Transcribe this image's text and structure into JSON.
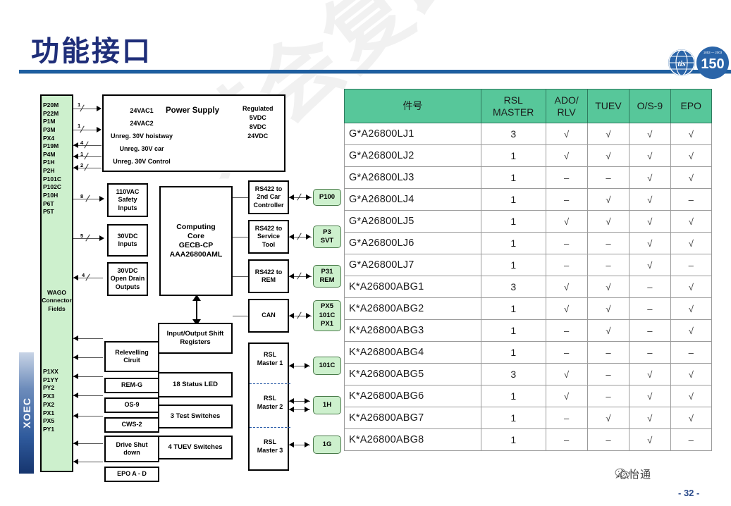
{
  "header": {
    "title": "功能接口",
    "rule_color": "#1f5fa0",
    "title_color": "#1f2e79"
  },
  "watermark": {
    "text": "禁会复印"
  },
  "logos": {
    "globe": "otis-globe-logo",
    "anniversary": "150-anniversary-logo",
    "anniversary_text": "150",
    "color": "#2a64a8"
  },
  "sidebar": {
    "label": "XOEC"
  },
  "diagram": {
    "wago": {
      "title": "WAGO\nConnector\nFields",
      "title_lines": [
        "WAGO",
        "Connector",
        "Fields"
      ],
      "top_labels": [
        "P20M",
        "P22M",
        "P1M",
        "P3M",
        "PX4",
        "P19M",
        "P4M",
        "P1H",
        "P2H",
        "P101C",
        "P102C",
        "P10H",
        "P6T",
        "P5T"
      ],
      "bottom_labels": [
        "P1XX",
        "P1YY",
        "PY2",
        "PX3",
        "PX2",
        "PX1",
        "PX5",
        "PY1"
      ],
      "fill": "#cdf0cd"
    },
    "power_supply": {
      "title": "Power Supply",
      "inputs": [
        "24VAC1",
        "24VAC2",
        "Unreg. 30V hoistway",
        "Unreg. 30V car",
        "Unreg. 30V Control"
      ],
      "outputs": [
        "Regulated",
        "5VDC",
        "8VDC",
        "24VDC"
      ]
    },
    "io_boxes": [
      {
        "name": "safety-inputs-box",
        "lines": [
          "110VAC",
          "Safety",
          "Inputs"
        ]
      },
      {
        "name": "dc-inputs-box",
        "lines": [
          "30VDC",
          "Inputs"
        ]
      },
      {
        "name": "open-drain-outputs-box",
        "lines": [
          "30VDC",
          "Open Drain",
          "Outputs"
        ]
      }
    ],
    "computing_core": {
      "lines": [
        "Computing",
        "Core",
        "GECB-CP",
        "AAA26800AML"
      ]
    },
    "comm_boxes": [
      {
        "name": "rs422-2nd-car-box",
        "lines": [
          "RS422 to",
          "2nd Car",
          "Controller"
        ]
      },
      {
        "name": "rs422-service-tool-box",
        "lines": [
          "RS422 to",
          "Service",
          "Tool"
        ]
      },
      {
        "name": "rs422-rem-box",
        "lines": [
          "RS422 to",
          "REM"
        ]
      },
      {
        "name": "can-box",
        "lines": [
          "CAN"
        ]
      }
    ],
    "ports": [
      {
        "name": "port-p100",
        "lines": [
          "P100"
        ]
      },
      {
        "name": "port-p3-svt",
        "lines": [
          "P3",
          "SVT"
        ]
      },
      {
        "name": "port-p31-rem",
        "lines": [
          "P31",
          "REM"
        ]
      },
      {
        "name": "port-px5-101c-px1",
        "lines": [
          "PX5",
          "101C",
          "PX1"
        ]
      },
      {
        "name": "port-101c",
        "lines": [
          "101C"
        ]
      },
      {
        "name": "port-1h",
        "lines": [
          "1H"
        ]
      },
      {
        "name": "port-1g",
        "lines": [
          "1G"
        ]
      }
    ],
    "rsl_masters": [
      "RSL\nMaster 1",
      "RSL\nMaster 2",
      "RSL\nMaster 3"
    ],
    "rsl_master_items": [
      {
        "lines": [
          "RSL",
          "Master 1"
        ]
      },
      {
        "lines": [
          "RSL",
          "Master 2"
        ]
      },
      {
        "lines": [
          "RSL",
          "Master 3"
        ]
      }
    ],
    "shift_registers": {
      "lines": [
        "Input/Output Shift",
        "Registers"
      ]
    },
    "left_lower_boxes": [
      {
        "name": "relevelling-circuit-box",
        "lines": [
          "Relevelling",
          "Ciruit"
        ]
      },
      {
        "name": "rem-g-box",
        "lines": [
          "REM-G"
        ]
      },
      {
        "name": "os-9-box",
        "lines": [
          "OS-9"
        ]
      },
      {
        "name": "cws-2-box",
        "lines": [
          "CWS-2"
        ]
      },
      {
        "name": "drive-shutdown-box",
        "lines": [
          "Drive Shut",
          "down"
        ]
      },
      {
        "name": "epo-a-d-box",
        "lines": [
          "EPO A - D"
        ]
      }
    ],
    "right_lower_boxes": [
      {
        "name": "status-led-box",
        "lines": [
          "18 Status  LED"
        ]
      },
      {
        "name": "test-switches-box",
        "lines": [
          "3 Test Switches"
        ]
      },
      {
        "name": "tuev-switches-box",
        "lines": [
          "4 TUEV Switches"
        ]
      }
    ],
    "wire_counts": [
      "1",
      "1",
      "4",
      "1",
      "2",
      "8",
      "5",
      "4"
    ]
  },
  "table": {
    "header_color": "#57c79a",
    "columns": [
      {
        "key": "part",
        "label": "件号"
      },
      {
        "key": "rsl",
        "label": "RSL\nMASTER",
        "lines": [
          "RSL",
          "MASTER"
        ]
      },
      {
        "key": "ado",
        "label": "ADO/\nRLV",
        "lines": [
          "ADO/",
          "RLV"
        ]
      },
      {
        "key": "tuev",
        "label": "TUEV",
        "lines": [
          "TUEV"
        ]
      },
      {
        "key": "os9",
        "label": "O/S-9",
        "lines": [
          "O/S-9"
        ]
      },
      {
        "key": "epo",
        "label": "EPO",
        "lines": [
          "EPO"
        ]
      }
    ],
    "rows": [
      {
        "part": "G*A26800LJ1",
        "rsl": "3",
        "ado": "√",
        "tuev": "√",
        "os9": "√",
        "epo": "√"
      },
      {
        "part": "G*A26800LJ2",
        "rsl": "1",
        "ado": "√",
        "tuev": "√",
        "os9": "√",
        "epo": "√"
      },
      {
        "part": "G*A26800LJ3",
        "rsl": "1",
        "ado": "–",
        "tuev": "–",
        "os9": "√",
        "epo": "√"
      },
      {
        "part": "G*A26800LJ4",
        "rsl": "1",
        "ado": "–",
        "tuev": "√",
        "os9": "√",
        "epo": "–"
      },
      {
        "part": "G*A26800LJ5",
        "rsl": "1",
        "ado": "√",
        "tuev": "√",
        "os9": "√",
        "epo": "√"
      },
      {
        "part": "G*A26800LJ6",
        "rsl": "1",
        "ado": "–",
        "tuev": "–",
        "os9": "√",
        "epo": "√"
      },
      {
        "part": "G*A26800LJ7",
        "rsl": "1",
        "ado": "–",
        "tuev": "–",
        "os9": "√",
        "epo": "–"
      },
      {
        "part": "K*A26800ABG1",
        "rsl": "3",
        "ado": "√",
        "tuev": "√",
        "os9": "–",
        "epo": "√"
      },
      {
        "part": "K*A26800ABG2",
        "rsl": "1",
        "ado": "√",
        "tuev": "√",
        "os9": "–",
        "epo": "√"
      },
      {
        "part": "K*A26800ABG3",
        "rsl": "1",
        "ado": "–",
        "tuev": "√",
        "os9": "–",
        "epo": "√"
      },
      {
        "part": "K*A26800ABG4",
        "rsl": "1",
        "ado": "–",
        "tuev": "–",
        "os9": "–",
        "epo": "–"
      },
      {
        "part": "K*A26800ABG5",
        "rsl": "3",
        "ado": "√",
        "tuev": "–",
        "os9": "√",
        "epo": "√"
      },
      {
        "part": "K*A26800ABG6",
        "rsl": "1",
        "ado": "√",
        "tuev": "–",
        "os9": "√",
        "epo": "√"
      },
      {
        "part": "K*A26800ABG7",
        "rsl": "1",
        "ado": "–",
        "tuev": "√",
        "os9": "√",
        "epo": "√"
      },
      {
        "part": "K*A26800ABG8",
        "rsl": "1",
        "ado": "–",
        "tuev": "–",
        "os9": "√",
        "epo": "–"
      }
    ]
  },
  "footer": {
    "brand": "心怡通",
    "page_number": "- 32 -"
  }
}
